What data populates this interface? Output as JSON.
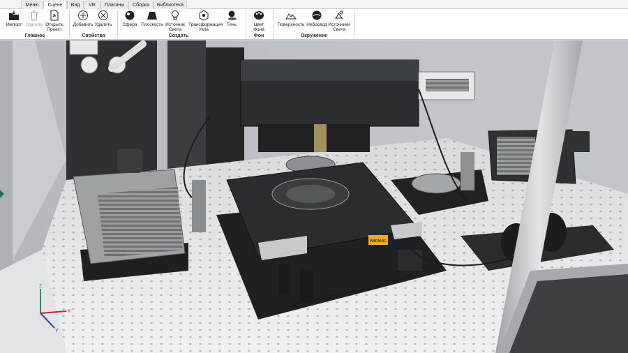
{
  "tabs": [
    {
      "label": "Меню"
    },
    {
      "label": "Сцене"
    },
    {
      "label": "Вид"
    },
    {
      "label": "VR"
    },
    {
      "label": "Плагины"
    },
    {
      "label": "Сборка"
    },
    {
      "label": "Библиотека"
    }
  ],
  "active_tab": "Сцене",
  "ribbon": {
    "main": {
      "label": "Главное",
      "import": "Импорт",
      "delete": "Удалить",
      "open_project_1": "Открыть",
      "open_project_2": "Проект"
    },
    "properties": {
      "label": "Свойства",
      "add": "Добавить",
      "remove": "Удалить"
    },
    "create": {
      "label": "Создать",
      "sphere": "Сфера",
      "plane": "Плоскость",
      "light_1": "Источник",
      "light_2": "Света",
      "transform_1": "Трансформация",
      "transform_2": "Узла",
      "shadow": "Тень"
    },
    "background": {
      "label": "Фон",
      "color_1": "Цвет",
      "color_2": "Фона"
    },
    "environment": {
      "label": "Окружение",
      "surface": "Поверхность",
      "sky": "Небосвод",
      "lights_1": "Источники",
      "lights_2": "Света"
    }
  },
  "scene": {
    "warning_label": "WARNING",
    "axes": {
      "z": "Z",
      "x": "X",
      "y": "Y"
    },
    "colors": {
      "x": "#d62020",
      "y": "#2040c8",
      "z": "#20a040"
    }
  }
}
